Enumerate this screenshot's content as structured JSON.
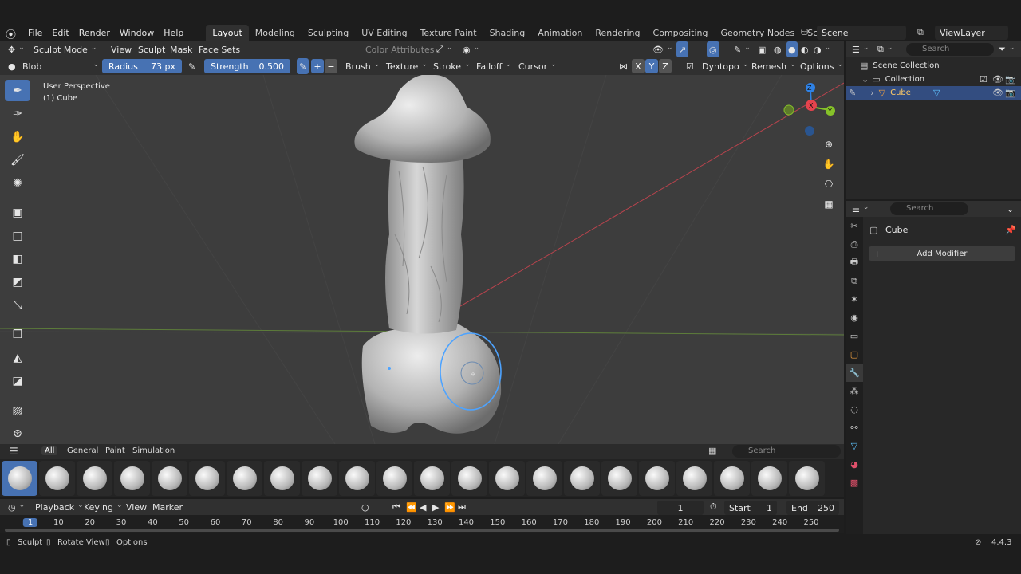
{
  "menu": {
    "items": [
      "File",
      "Edit",
      "Render",
      "Window",
      "Help"
    ]
  },
  "workspaces": {
    "tabs": [
      "Layout",
      "Modeling",
      "Sculpting",
      "UV Editing",
      "Texture Paint",
      "Shading",
      "Animation",
      "Rendering",
      "Compositing",
      "Geometry Nodes",
      "Scripting"
    ],
    "active": "Layout"
  },
  "scene": {
    "label": "Scene",
    "view_layer": "ViewLayer"
  },
  "viewport_header": {
    "mode": "Sculpt Mode",
    "menus": [
      "View",
      "Sculpt",
      "Mask",
      "Face Sets"
    ],
    "color_attributes": "Color Attributes"
  },
  "tool_header": {
    "brush_name": "Blob",
    "radius_label": "Radius",
    "radius_value": "73 px",
    "strength_label": "Strength",
    "strength_value": "0.500",
    "plus": "+",
    "minus": "−",
    "menus": [
      "Brush",
      "Texture",
      "Stroke",
      "Falloff",
      "Cursor"
    ],
    "axes": [
      "X",
      "Y",
      "Z"
    ],
    "dyntopo": "Dyntopo",
    "remesh": "Remesh",
    "options": "Options"
  },
  "viewport": {
    "perspective": "User Perspective",
    "object": "(1) Cube"
  },
  "gizmo": {
    "z": "Z",
    "x": "X",
    "y": "Y"
  },
  "asset_shelf": {
    "tabs": [
      "All",
      "General",
      "Paint",
      "Simulation"
    ],
    "active": "All",
    "search_placeholder": "Search"
  },
  "timeline": {
    "menus": [
      "Playback",
      "Keying",
      "View",
      "Marker"
    ],
    "current_frame": "1",
    "start_label": "Start",
    "start": "1",
    "end_label": "End",
    "end": "250",
    "ticks": [
      "1",
      "10",
      "20",
      "30",
      "40",
      "50",
      "60",
      "70",
      "80",
      "90",
      "100",
      "110",
      "120",
      "130",
      "140",
      "150",
      "160",
      "170",
      "180",
      "190",
      "200",
      "210",
      "220",
      "230",
      "240",
      "250"
    ]
  },
  "status": {
    "sculpt": "Sculpt",
    "rotate": "Rotate View",
    "options": "Options",
    "version": "4.4.3"
  },
  "outliner": {
    "search_placeholder": "Search",
    "scene_collection": "Scene Collection",
    "collection": "Collection",
    "object": "Cube"
  },
  "properties": {
    "search_placeholder": "Search",
    "object": "Cube",
    "add_modifier": "Add Modifier"
  },
  "colors": {
    "accent": "#4772b3",
    "viewport_bg": "#3d3d3d",
    "selected_row": "#334d80",
    "axis_x": "#e5434d",
    "axis_y": "#86c229",
    "axis_z": "#2f82e6"
  }
}
